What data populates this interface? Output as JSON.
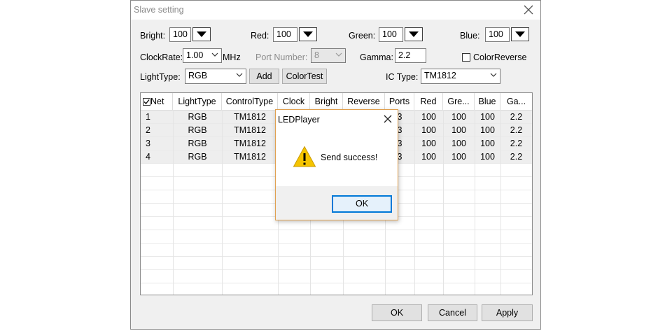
{
  "window": {
    "title": "Slave setting"
  },
  "controls": {
    "bright_label": "Bright:",
    "bright_value": "100",
    "red_label": "Red:",
    "red_value": "100",
    "green_label": "Green:",
    "green_value": "100",
    "blue_label": "Blue:",
    "blue_value": "100",
    "clockrate_label": "ClockRate:",
    "clockrate_value": "1.00",
    "clockrate_unit": "MHz",
    "portnumber_label": "Port Number:",
    "portnumber_value": "8",
    "gamma_label": "Gamma:",
    "gamma_value": "2.2",
    "colorreverse_label": "ColorReverse",
    "lighttype_label": "LightType:",
    "lighttype_value": "RGB",
    "add_label": "Add",
    "colortest_label": "ColorTest",
    "ictype_label": "IC Type:",
    "ictype_value": "TM1812"
  },
  "table": {
    "columns": [
      "Net",
      "LightType",
      "ControlType",
      "Clock",
      "Bright",
      "Reverse",
      "Ports",
      "Red",
      "Gre...",
      "Blue",
      "Ga..."
    ],
    "rows": [
      [
        "1",
        "RGB",
        "TM1812",
        "",
        "",
        "",
        "3",
        "100",
        "100",
        "100",
        "2.2"
      ],
      [
        "2",
        "RGB",
        "TM1812",
        "",
        "",
        "",
        "3",
        "100",
        "100",
        "100",
        "2.2"
      ],
      [
        "3",
        "RGB",
        "TM1812",
        "",
        "",
        "",
        "3",
        "100",
        "100",
        "100",
        "2.2"
      ],
      [
        "4",
        "RGB",
        "TM1812",
        "",
        "",
        "",
        "3",
        "100",
        "100",
        "100",
        "2.2"
      ]
    ]
  },
  "footer": {
    "ok_label": "OK",
    "cancel_label": "Cancel",
    "apply_label": "Apply"
  },
  "dialog": {
    "title": "LEDPlayer",
    "message": "Send success!",
    "ok_label": "OK"
  },
  "icons": {
    "close": "close-icon",
    "warning": "warning-icon",
    "dropdown": "dropdown-arrow-icon",
    "chevron": "chevron-down-icon",
    "checkbox": "checkbox-icon"
  },
  "colors": {
    "focus_blue": "#0078d7",
    "warning_yellow": "#f5c400",
    "dialog_border": "#e0a050"
  }
}
